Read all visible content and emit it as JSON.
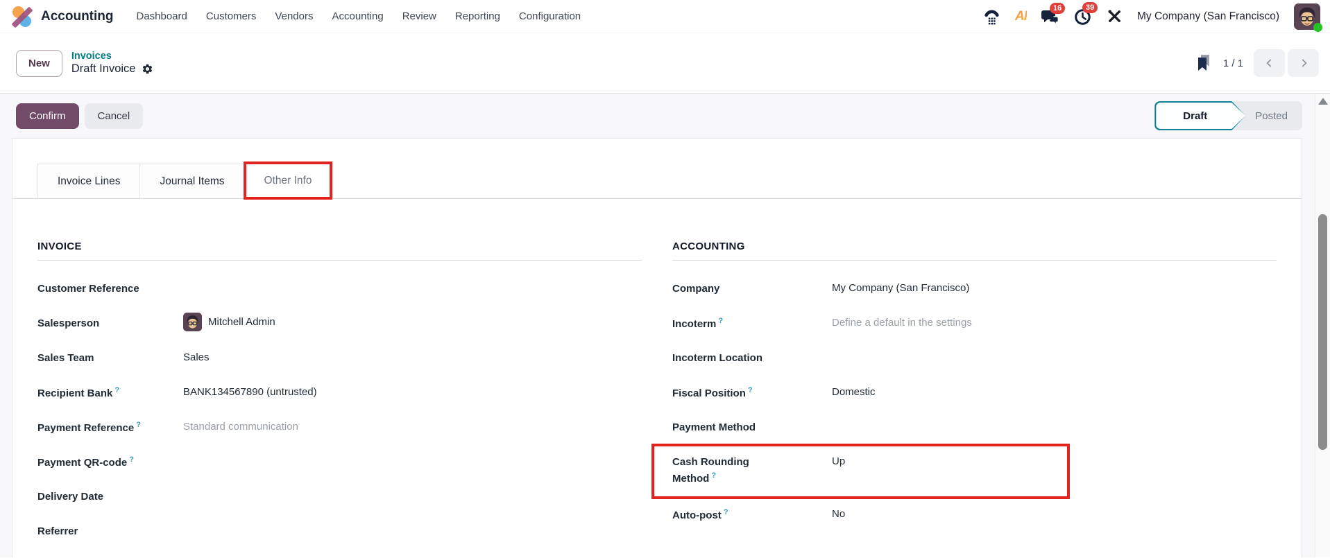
{
  "navbar": {
    "app_name": "Accounting",
    "menu": [
      "Dashboard",
      "Customers",
      "Vendors",
      "Accounting",
      "Review",
      "Reporting",
      "Configuration"
    ],
    "badges": {
      "messages": "16",
      "activities": "39"
    },
    "company": "My Company (San Francisco)",
    "icons": [
      "voip-phone-icon",
      "ai-icon",
      "messages-icon",
      "activities-clock-icon",
      "tools-icon",
      "user-avatar"
    ]
  },
  "control_panel": {
    "new_button": "New",
    "breadcrumb": {
      "parent": "Invoices",
      "current": "Draft Invoice"
    },
    "pager": {
      "value": "1 / 1"
    },
    "icons": [
      "bookmark-icon",
      "settings-gear-icon",
      "prev-chevron-icon",
      "next-chevron-icon"
    ]
  },
  "actions": {
    "confirm": "Confirm",
    "cancel": "Cancel"
  },
  "statusbar": {
    "draft": "Draft",
    "posted": "Posted",
    "active_state": "Draft"
  },
  "tabs": [
    {
      "label": "Invoice Lines",
      "active": false
    },
    {
      "label": "Journal Items",
      "active": false
    },
    {
      "label": "Other Info",
      "active": true,
      "annotated": true
    }
  ],
  "invoice_section": {
    "title": "INVOICE",
    "fields": [
      {
        "label": "Customer Reference",
        "value": ""
      },
      {
        "label": "Salesperson",
        "value": "Mitchell Admin"
      },
      {
        "label": "Sales Team",
        "value": "Sales"
      },
      {
        "label": "Recipient Bank",
        "help": "?",
        "value": "BANK134567890 (untrusted)"
      },
      {
        "label": "Payment Reference",
        "help": "?",
        "placeholder": "Standard communication"
      },
      {
        "label": "Payment QR-code",
        "help": "?",
        "value": ""
      },
      {
        "label": "Delivery Date",
        "value": ""
      },
      {
        "label": "Referrer",
        "value": ""
      }
    ]
  },
  "accounting_section": {
    "title": "ACCOUNTING",
    "fields": [
      {
        "label": "Company",
        "value": "My Company (San Francisco)"
      },
      {
        "label": "Incoterm",
        "help": "?",
        "placeholder": "Define a default in the settings"
      },
      {
        "label": "Incoterm Location",
        "value": ""
      },
      {
        "label": "Fiscal Position",
        "help": "?",
        "value": "Domestic"
      },
      {
        "label": "Payment Method",
        "value": ""
      },
      {
        "label": "Cash Rounding Method",
        "help": "?",
        "value": "Up",
        "annotated": true
      },
      {
        "label": "Auto-post",
        "help": "?",
        "value": "No"
      }
    ]
  },
  "colors": {
    "accent": "#714B67",
    "link": "#017E84",
    "state_border": "#0E8095",
    "annotation": "#E2231E",
    "badge": "#E0403C"
  }
}
